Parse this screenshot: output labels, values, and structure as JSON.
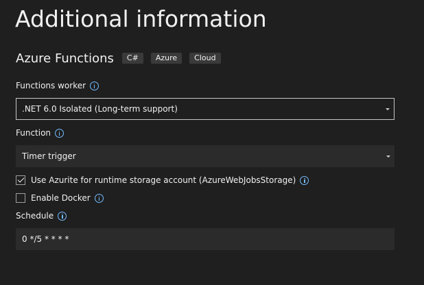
{
  "page": {
    "title": "Additional information"
  },
  "project": {
    "name": "Azure Functions",
    "tags": [
      "C#",
      "Azure",
      "Cloud"
    ]
  },
  "functions_worker": {
    "label": "Functions worker",
    "selected": ".NET 6.0 Isolated (Long-term support)"
  },
  "function": {
    "label": "Function",
    "selected": "Timer trigger"
  },
  "azurite": {
    "label": "Use Azurite for runtime storage account (AzureWebJobsStorage)",
    "checked": true
  },
  "docker": {
    "label": "Enable Docker",
    "checked": false
  },
  "schedule": {
    "label": "Schedule",
    "value": "0 */5 * * * *"
  },
  "colors": {
    "background": "#1f1f1f",
    "field": "#2b2b2b",
    "tag": "#3a3a3a",
    "info_accent": "#75beff"
  },
  "icons": {
    "info": "info-icon",
    "dropdown": "chevron-down-icon",
    "check": "check-icon"
  }
}
